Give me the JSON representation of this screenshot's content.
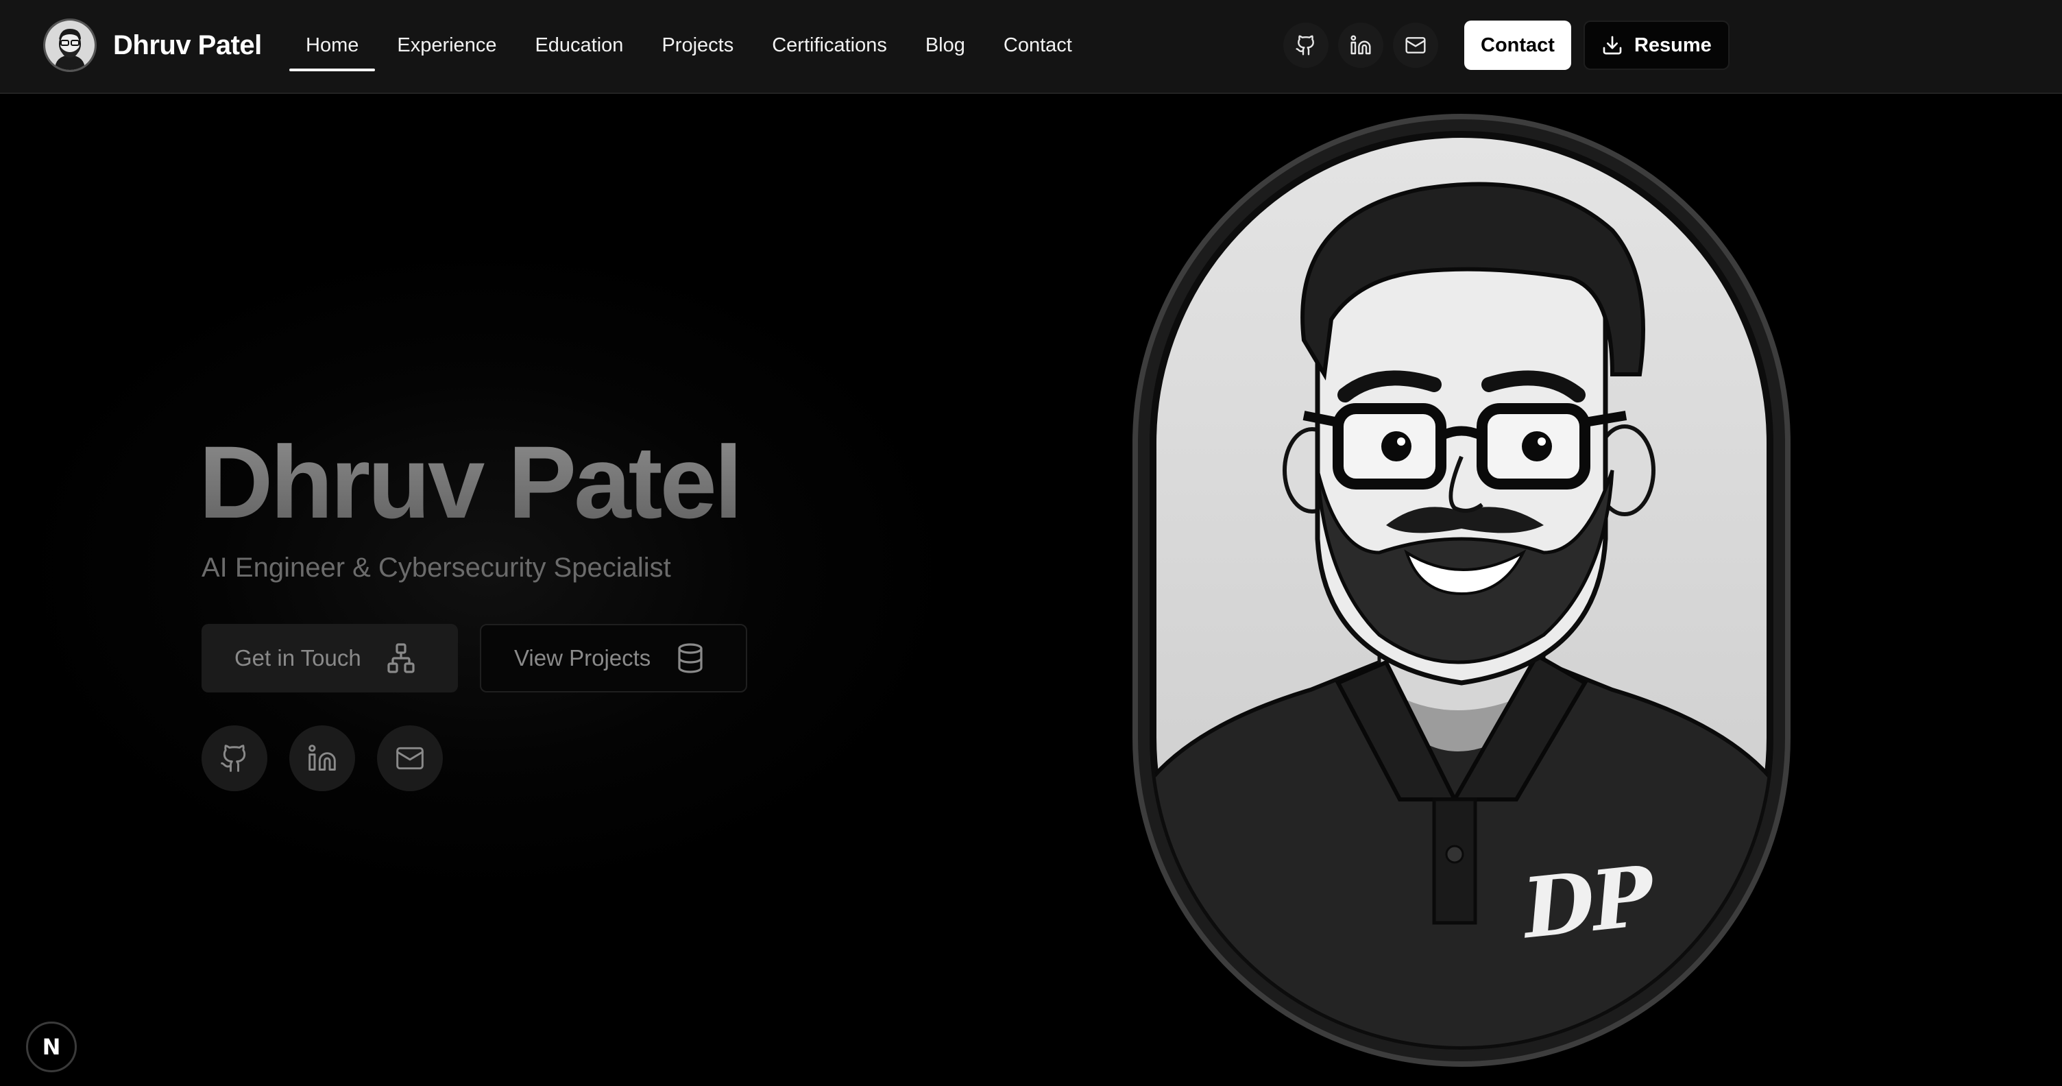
{
  "brand": {
    "name": "Dhruv Patel",
    "avatar_icon": "avatar-icon"
  },
  "nav": {
    "links": [
      {
        "label": "Home",
        "active": true
      },
      {
        "label": "Experience",
        "active": false
      },
      {
        "label": "Education",
        "active": false
      },
      {
        "label": "Projects",
        "active": false
      },
      {
        "label": "Certifications",
        "active": false
      },
      {
        "label": "Blog",
        "active": false
      },
      {
        "label": "Contact",
        "active": false
      }
    ],
    "icons": [
      "github-icon",
      "linkedin-icon",
      "mail-icon"
    ],
    "contact_label": "Contact",
    "resume_label": "Resume",
    "resume_icon": "download-icon"
  },
  "hero": {
    "title": "Dhruv Patel",
    "subtitle": "AI Engineer & Cybersecurity Specialist",
    "primary_cta": {
      "label": "Get in Touch",
      "icon": "sitemap-icon"
    },
    "secondary_cta": {
      "label": "View Projects",
      "icon": "database-icon"
    },
    "socials": [
      "github-icon",
      "linkedin-icon",
      "mail-icon"
    ]
  },
  "portrait": {
    "shirt_monogram": "DP"
  },
  "dev_badge": {
    "label": "N"
  },
  "colors": {
    "background": "#000000",
    "navbar": "#141414",
    "accent": "#ffffff",
    "muted_text": "#6b6b6b"
  }
}
